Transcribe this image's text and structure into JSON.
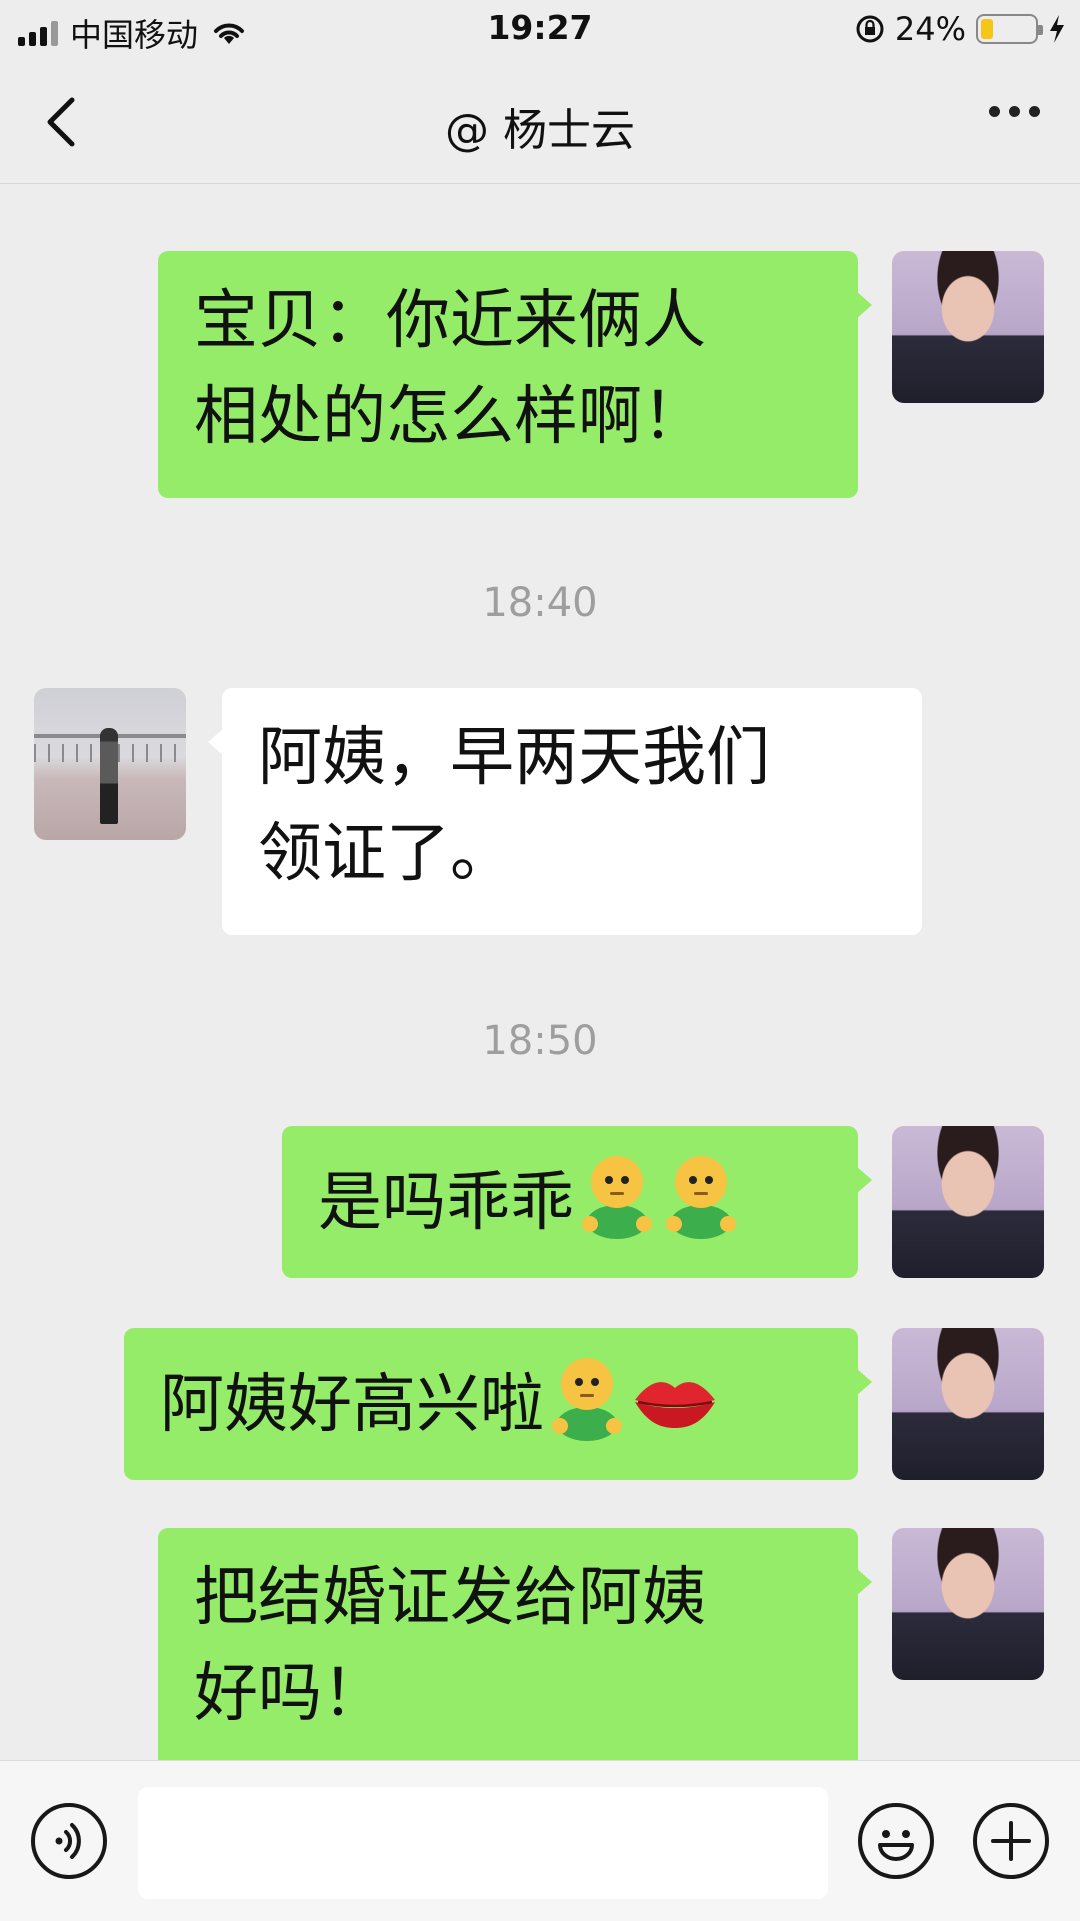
{
  "status_bar": {
    "carrier": "中国移动",
    "time": "19:27",
    "battery_percent_text": "24%",
    "battery_level": 0.24
  },
  "header": {
    "title": "@ 杨士云"
  },
  "messages": [
    {
      "sender": "self",
      "text": "宝贝：你近来俩人相处的怎么样啊！",
      "line1": "宝贝：你近来俩人",
      "line2": "相处的怎么样啊！"
    },
    {
      "type": "timestamp",
      "text": "18:40"
    },
    {
      "sender": "other",
      "text": "阿姨，早两天我们领证了。",
      "line1": "阿姨，早两天我们",
      "line2": "领证了。"
    },
    {
      "type": "timestamp",
      "text": "18:50"
    },
    {
      "sender": "self",
      "text": "是吗乖乖",
      "emoji": [
        "green-figure-emoji",
        "green-figure-emoji"
      ]
    },
    {
      "sender": "self",
      "text": "阿姨好高兴啦",
      "emoji": [
        "green-figure-emoji",
        "lips-emoji"
      ]
    },
    {
      "sender": "self",
      "text": "把结婚证发给阿姨好吗！",
      "line1": "把结婚证发给阿姨",
      "line2": "好吗！"
    }
  ],
  "colors": {
    "self_bubble": "#95ec69",
    "other_bubble": "#ffffff",
    "background": "#ededed",
    "timestamp": "#9e9e9e"
  },
  "input_bar": {
    "message_value": ""
  }
}
